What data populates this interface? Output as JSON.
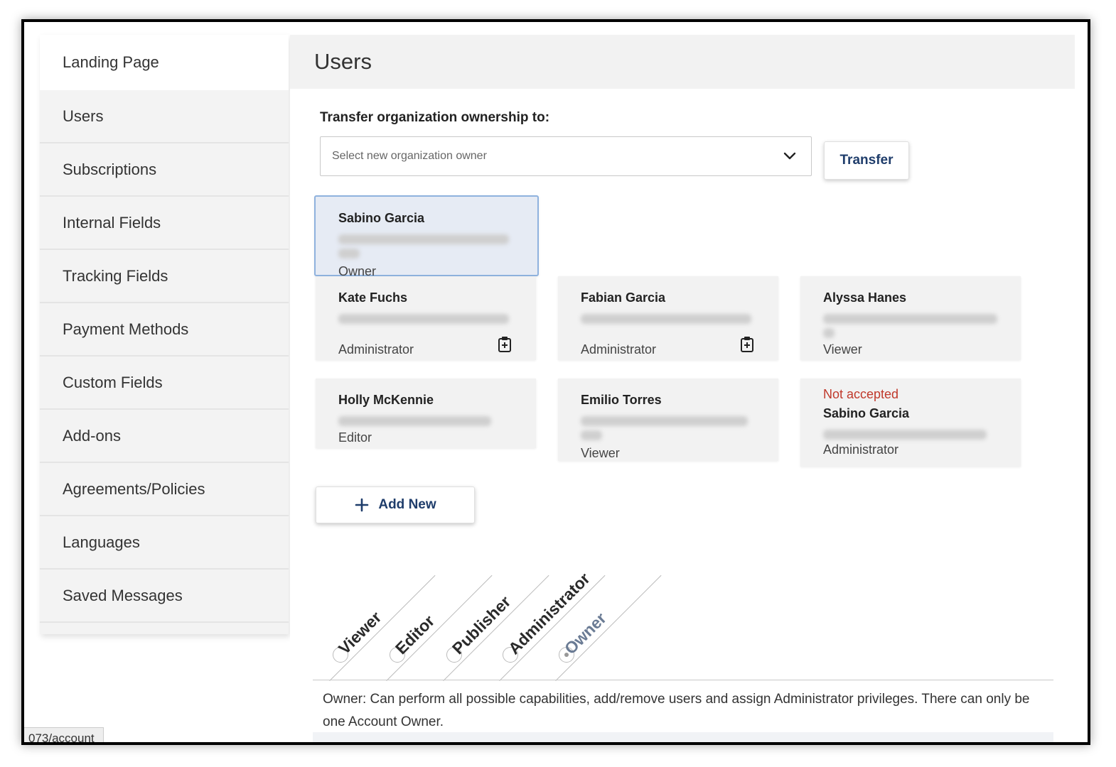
{
  "sidebar": {
    "items": [
      {
        "label": "Landing Page"
      },
      {
        "label": "Users"
      },
      {
        "label": "Subscriptions"
      },
      {
        "label": "Internal Fields"
      },
      {
        "label": "Tracking Fields"
      },
      {
        "label": "Payment Methods"
      },
      {
        "label": "Custom Fields"
      },
      {
        "label": "Add-ons"
      },
      {
        "label": "Agreements/Policies"
      },
      {
        "label": "Languages"
      },
      {
        "label": "Saved Messages"
      }
    ]
  },
  "main": {
    "title": "Users",
    "transfer_label": "Transfer organization ownership to:",
    "select_placeholder": "Select new organization owner",
    "transfer_button": "Transfer",
    "add_button": "Add New"
  },
  "users": [
    {
      "name": "Sabino Garcia",
      "role": "Owner"
    },
    {
      "name": "Kate Fuchs",
      "role": "Administrator"
    },
    {
      "name": "Fabian Garcia",
      "role": "Administrator"
    },
    {
      "name": "Alyssa Hanes",
      "role": "Viewer"
    },
    {
      "name": "Holly McKennie",
      "role": "Editor"
    },
    {
      "name": "Emilio Torres",
      "role": "Viewer"
    },
    {
      "name": "Sabino Garcia",
      "role": "Administrator",
      "status": "Not accepted"
    }
  ],
  "roles": [
    "Viewer",
    "Editor",
    "Publisher",
    "Administrator",
    "Owner"
  ],
  "role_description": "Owner: Can perform all possible capabilities, add/remove users and assign Administrator privileges. There can only be one Account Owner.",
  "status_bar_url": "073/account",
  "colors": {
    "accent": "#1f3d6b",
    "owner_card": "#e6ebf4",
    "owner_border": "#8fb2de",
    "warning": "#c0392b"
  }
}
